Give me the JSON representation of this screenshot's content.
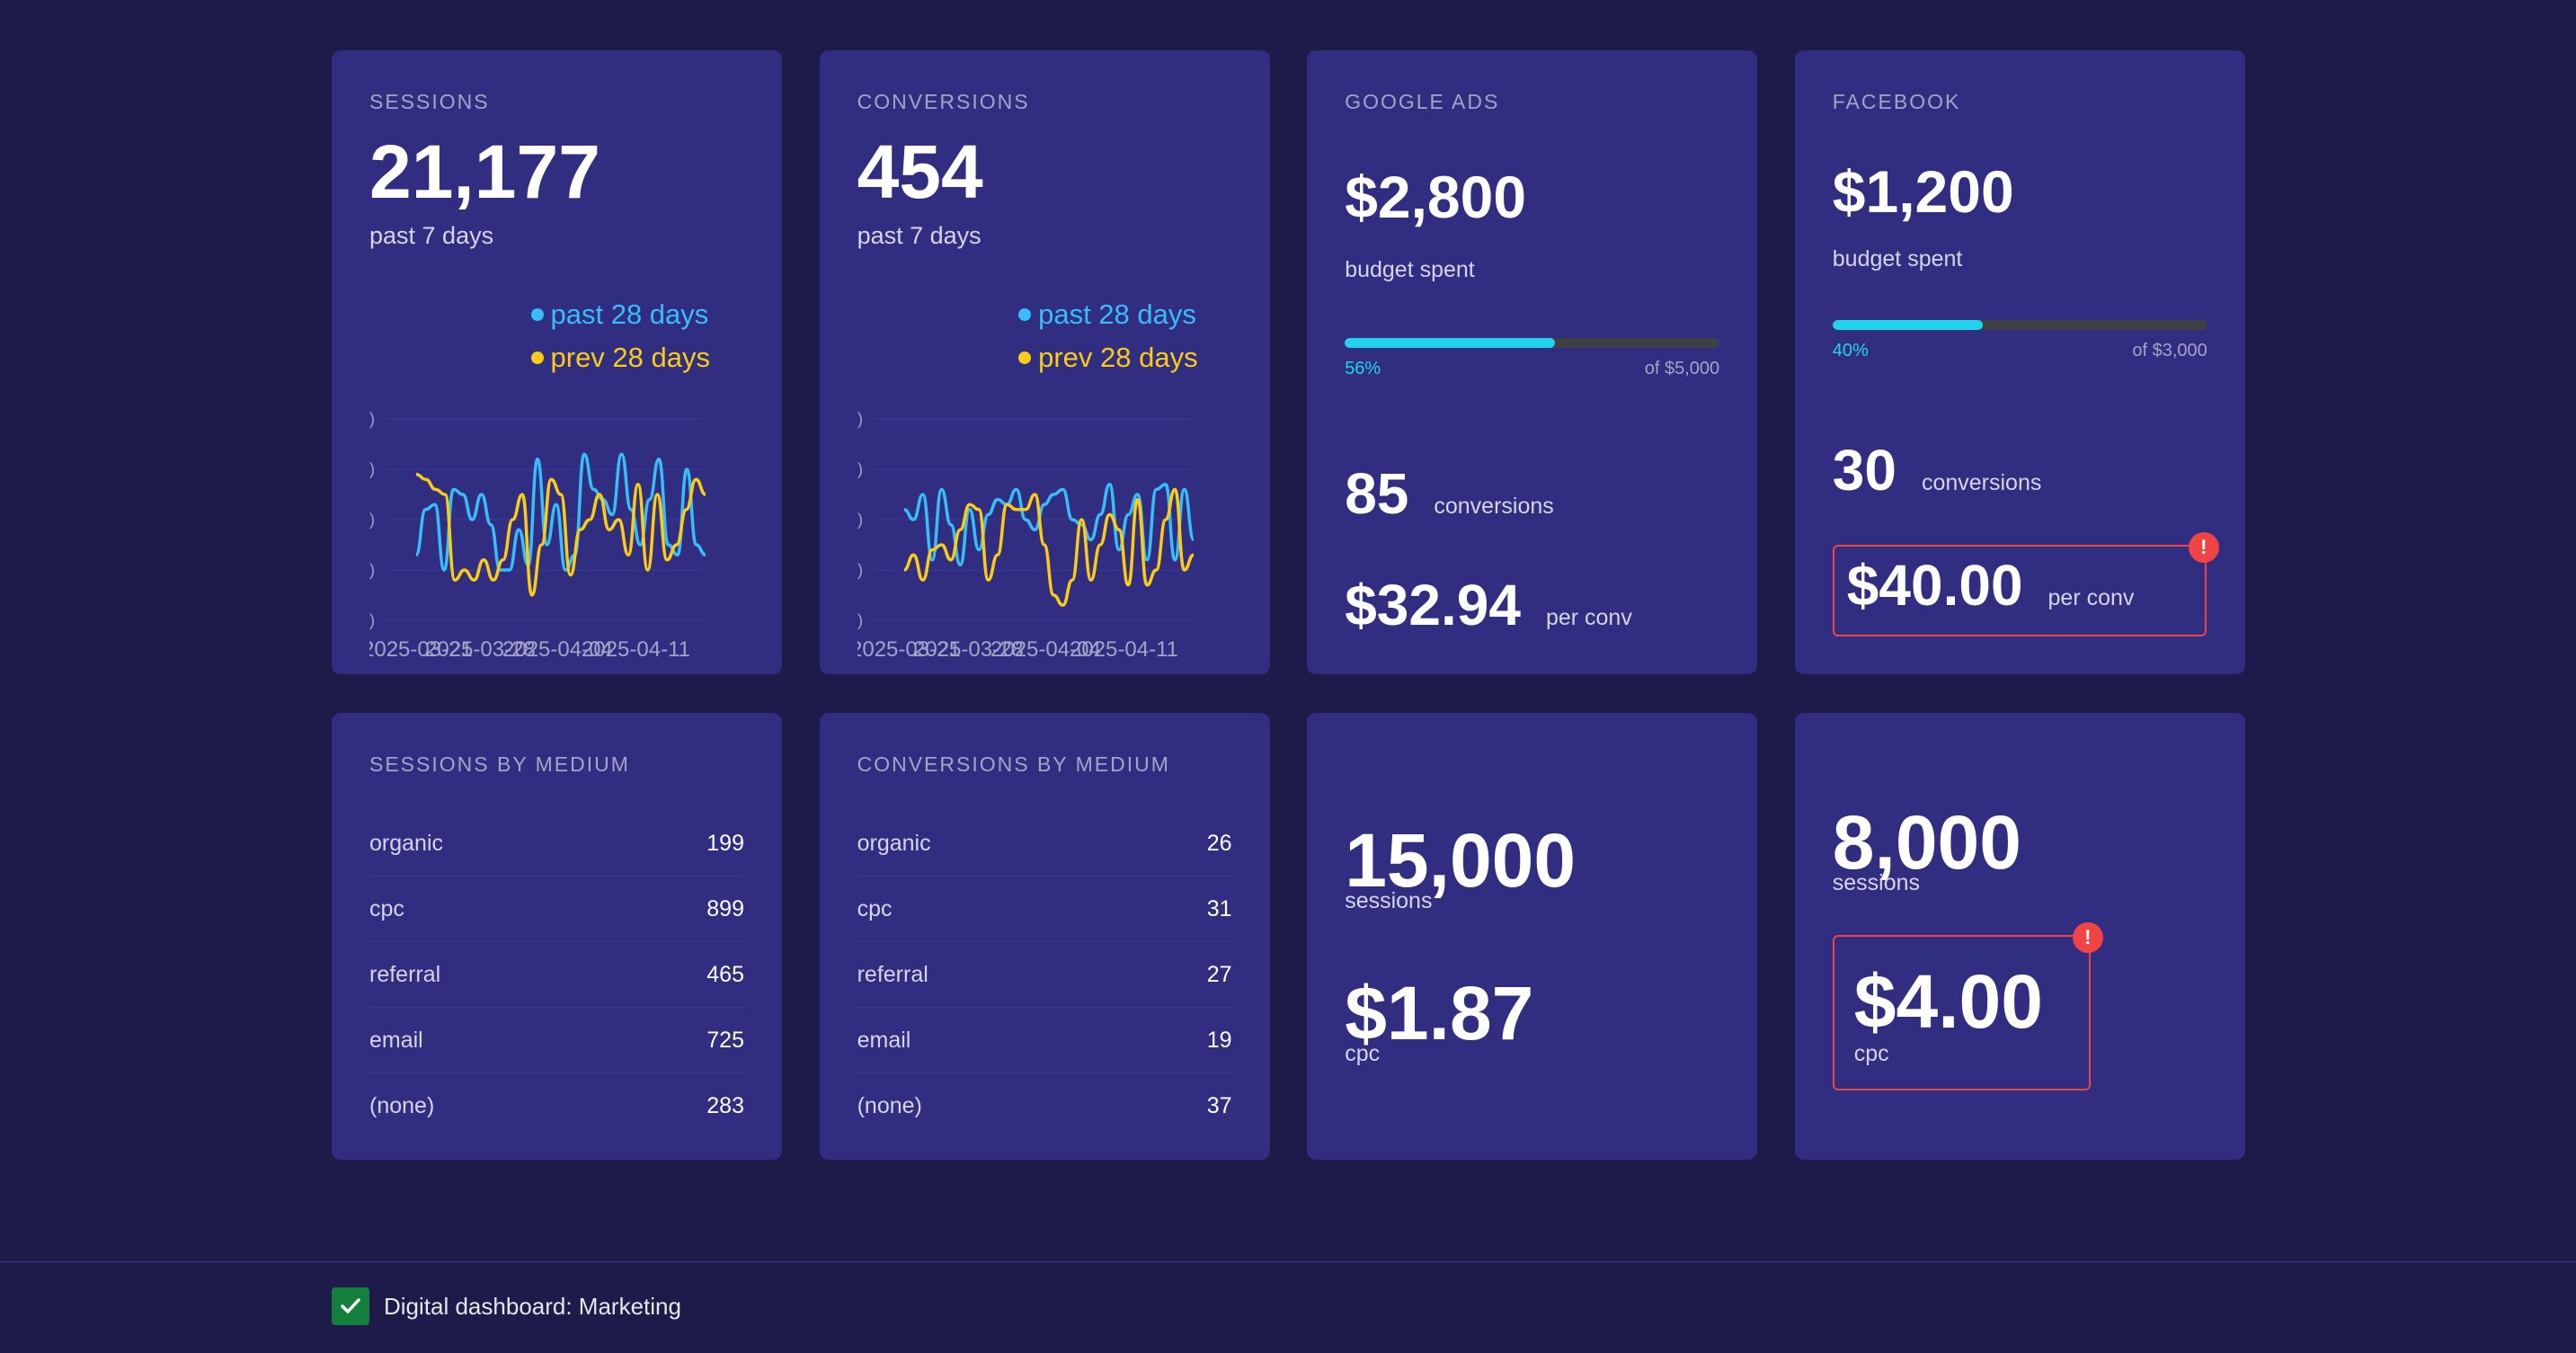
{
  "colors": {
    "background": "#1e1b4b",
    "card": "#312e81",
    "series_past": "#38bdf8",
    "series_prev": "#facc15",
    "progress": "#22d3ee",
    "alert": "#ef4444"
  },
  "cards": {
    "sessions": {
      "title": "SESSIONS",
      "value": "21,177",
      "subtitle": "past 7 days",
      "legend_past": "past 28 days",
      "legend_prev": "prev 28 days"
    },
    "conversions": {
      "title": "CONVERSIONS",
      "value": "454",
      "subtitle": "past 7 days",
      "legend_past": "past 28 days",
      "legend_prev": "prev 28 days"
    },
    "google_ads": {
      "title": "GOOGLE ADS",
      "budget": "$2,800",
      "budget_label": "budget spent",
      "progress_pct_label": "56%",
      "progress_fraction": 0.56,
      "progress_of": "of $5,000",
      "conversions": "85",
      "conversions_label": "conversions",
      "per_conv": "$32.94",
      "per_conv_label": "per conv"
    },
    "facebook": {
      "title": "FACEBOOK",
      "budget": "$1,200",
      "budget_label": "budget spent",
      "progress_pct_label": "40%",
      "progress_fraction": 0.4,
      "progress_of": "of $3,000",
      "conversions": "30",
      "conversions_label": "conversions",
      "per_conv": "$40.00",
      "per_conv_label": "per conv",
      "alert_icon": "!"
    },
    "sessions_by_medium": {
      "title": "SESSIONS BY MEDIUM",
      "rows": [
        {
          "label": "organic",
          "value": "199"
        },
        {
          "label": "cpc",
          "value": "899"
        },
        {
          "label": "referral",
          "value": "465"
        },
        {
          "label": "email",
          "value": "725"
        },
        {
          "label": "(none)",
          "value": "283"
        }
      ]
    },
    "conversions_by_medium": {
      "title": "CONVERSIONS BY MEDIUM",
      "rows": [
        {
          "label": "organic",
          "value": "26"
        },
        {
          "label": "cpc",
          "value": "31"
        },
        {
          "label": "referral",
          "value": "27"
        },
        {
          "label": "email",
          "value": "19"
        },
        {
          "label": "(none)",
          "value": "37"
        }
      ]
    },
    "google_sessions": {
      "sessions": "15,000",
      "sessions_label": "sessions",
      "cpc": "$1.87",
      "cpc_label": "cpc"
    },
    "facebook_sessions": {
      "sessions": "8,000",
      "sessions_label": "sessions",
      "cpc": "$4.00",
      "cpc_label": "cpc",
      "alert_icon": "!"
    }
  },
  "footer": {
    "title": "Digital dashboard: Marketing",
    "icon": "check-icon"
  },
  "chart_data": [
    {
      "type": "line",
      "title": "",
      "x_tick_labels": [
        "2025-03-21",
        "2025-03-28",
        "2025-04-04",
        "2025-04-11"
      ],
      "ylim": [
        0,
        4
      ],
      "series": [
        {
          "name": "past 28 days",
          "color": "#38bdf8",
          "values": [
            1.3,
            2.2,
            2.3,
            1.0,
            2.6,
            2.5,
            2.0,
            2.5,
            1.9,
            1.0,
            1.0,
            1.8,
            1.1,
            3.2,
            1.5,
            2.3,
            1.0,
            1.3,
            3.3,
            2.6,
            2.4,
            2.1,
            3.3,
            2.2,
            1.5,
            2.4,
            3.2,
            1.5,
            1.3,
            3.0,
            1.5,
            1.3
          ]
        },
        {
          "name": "prev 28 days",
          "color": "#facc15",
          "values": [
            2.9,
            2.8,
            2.6,
            2.5,
            0.8,
            1.0,
            0.8,
            1.2,
            0.8,
            1.2,
            2.0,
            2.5,
            0.5,
            1.5,
            2.8,
            2.5,
            0.9,
            1.8,
            2.0,
            2.5,
            1.8,
            2.0,
            1.3,
            2.7,
            1.0,
            2.5,
            1.2,
            1.5,
            2.2,
            2.8,
            2.5
          ]
        }
      ]
    },
    {
      "type": "line",
      "title": "",
      "x_tick_labels": [
        "2025-03-21",
        "2025-03-28",
        "2025-04-04",
        "2025-04-11"
      ],
      "ylim": [
        0,
        4
      ],
      "series": [
        {
          "name": "past 28 days",
          "color": "#38bdf8",
          "values": [
            2.2,
            2.0,
            2.5,
            1.2,
            2.6,
            1.9,
            1.1,
            2.2,
            1.4,
            2.1,
            2.4,
            2.3,
            2.6,
            2.0,
            1.8,
            2.3,
            2.5,
            2.6,
            2.0,
            1.9,
            1.6,
            2.1,
            2.7,
            1.4,
            2.1,
            2.5,
            1.2,
            2.6,
            2.7,
            1.2,
            2.6,
            1.6
          ]
        },
        {
          "name": "prev 28 days",
          "color": "#facc15",
          "values": [
            1.0,
            1.3,
            0.8,
            1.4,
            1.5,
            1.2,
            1.8,
            2.3,
            2.2,
            0.8,
            1.3,
            2.3,
            2.2,
            2.2,
            2.5,
            1.5,
            0.5,
            0.3,
            0.8,
            2.0,
            0.8,
            1.5,
            2.1,
            1.8,
            0.7,
            2.4,
            0.7,
            1.0,
            2.0,
            2.6,
            1.0,
            1.3
          ]
        }
      ]
    }
  ]
}
